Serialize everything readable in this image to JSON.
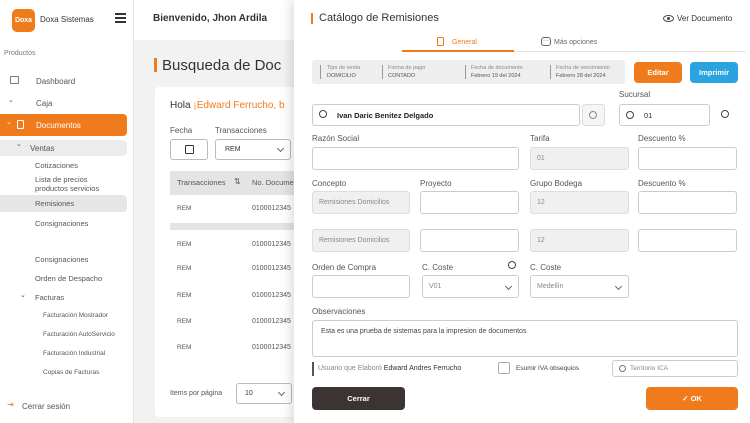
{
  "app": {
    "logo_text": "Doxa",
    "name": "Doxa Sistemas",
    "welcome": "Bienvenido, Jhon Ardila"
  },
  "sidebar": {
    "section": "Productos",
    "items": [
      "Dashboard",
      "Caja",
      "Documentos",
      "Ventas",
      "Cotizaciones",
      "Lista de precios productos servicios",
      "Remisiones",
      "Consignaciones",
      "Consignaciones",
      "Orden de Despacho",
      "Facturas",
      "Facturación Mostrador",
      "Facturación AutoServicio",
      "Facturación Industrial",
      "Copias de Facturas"
    ],
    "logout": "Cerrar sesión"
  },
  "background": {
    "title": "Busqueda de Doc",
    "greeting": "Hola",
    "user": "¡Edward Ferrucho, b",
    "fecha_label": "Fecha",
    "trans_label": "Transacciones",
    "trans_value": "REM",
    "col1": "Transacciones",
    "col2": "No. Documen",
    "rows": [
      [
        "REM",
        "0100012345"
      ],
      [
        "REM",
        "0100012345"
      ],
      [
        "REM",
        "0100012345"
      ],
      [
        "REM",
        "0100012345"
      ],
      [
        "REM",
        "0100012345"
      ],
      [
        "REM",
        "0100012345"
      ]
    ],
    "items_label": "Items por página",
    "items_value": "10"
  },
  "modal": {
    "title": "Catálogo de Remisiones",
    "ver_doc": "Ver Documento",
    "tab_general": "General",
    "tab_mas": "Más opciones",
    "info": [
      {
        "label": "Tipo de venta",
        "value": "DOMICILIO"
      },
      {
        "label": "Forma de pago",
        "value": "CONTADO"
      },
      {
        "label": "Fecha de documento",
        "value": "Febrero 19 del 2024"
      },
      {
        "label": "Fecha de vencimiento",
        "value": "Febrero 28 del 2024"
      }
    ],
    "editar": "Editar",
    "imprimir": "Imprimir",
    "search_value": "Ivan Daric Benitez Delgado",
    "sucursal_label": "Sucursal",
    "sucursal_value": "01",
    "razon_label": "Razón Social",
    "tarifa_label": "Tarifa",
    "tarifa_value": "01",
    "desc1_label": "Descuento %",
    "concepto_label": "Concepto",
    "concepto_value": "Remisiones Domicilios",
    "proyecto_label": "Proyecto",
    "grupo_label": "Grupo Bodega",
    "grupo_value": "12",
    "desc2_label": "Descuento %",
    "concepto2_value": "Remisiones Domicilios",
    "grupo2_value": "12",
    "orden_label": "Orden de Compra",
    "ccoste1_label": "C. Coste",
    "ccoste1_value": "V01",
    "ccoste2_label": "C. Coste",
    "ccoste2_value": "Medellín",
    "obs_label": "Observaciones",
    "obs_value": "Esta es una prueba de sistemas para la impresion de documentos",
    "elaboro_label": "Usuario que Elaboró",
    "elaboro_value": "Edward Andres Ferrucho",
    "iva_label": "Esumir IVA obsequios",
    "territorio": "Territorio ICA",
    "cerrar": "Cerrar",
    "ok": "OK"
  },
  "colors": {
    "accent": "#f07b1d",
    "blue": "#2aa3e0",
    "dark": "#3c3333"
  }
}
